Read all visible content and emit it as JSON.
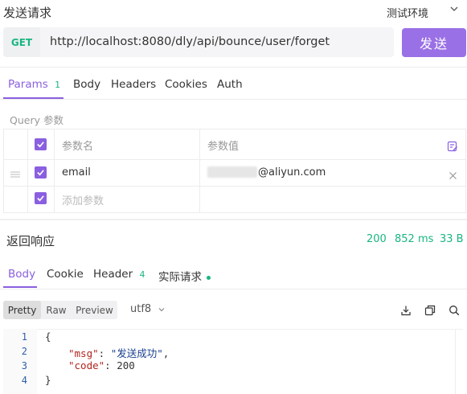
{
  "header": {
    "title": "发送请求",
    "environment": "测试环境"
  },
  "request": {
    "method": "GET",
    "url": "http://localhost:8080/dly/api/bounce/user/forget",
    "send_label": "发送"
  },
  "request_tabs": [
    {
      "label": "Params",
      "badge": "1"
    },
    {
      "label": "Body"
    },
    {
      "label": "Headers"
    },
    {
      "label": "Cookies"
    },
    {
      "label": "Auth"
    }
  ],
  "query": {
    "label": "Query 参数",
    "col_name": "参数名",
    "col_value": "参数值",
    "rows": [
      {
        "name": "email",
        "value_suffix": "@aliyun.com"
      }
    ],
    "add_placeholder": "添加参数"
  },
  "response": {
    "title": "返回响应",
    "status_code": "200",
    "time": "852 ms",
    "size": "33 B",
    "tabs": [
      {
        "label": "Body"
      },
      {
        "label": "Cookie"
      },
      {
        "label": "Header",
        "badge": "4"
      },
      {
        "label": "实际请求"
      }
    ],
    "view_modes": [
      "Pretty",
      "Raw",
      "Preview"
    ],
    "encoding": "utf8",
    "code": {
      "line_numbers": [
        "1",
        "2",
        "3",
        "4"
      ],
      "open_brace": "{",
      "msg_key": "\"msg\"",
      "msg_value": "\"发送成功\"",
      "code_key": "\"code\"",
      "code_value": "200",
      "close_brace": "}"
    }
  },
  "colors": {
    "accent": "#8a5fe0",
    "send_button": "#9a70e6",
    "success": "#19b67f"
  },
  "icons": [
    "chevron-down-icon",
    "check-icon",
    "drag-handle-icon",
    "bulk-edit-icon",
    "remove-icon",
    "download-icon",
    "copy-icon",
    "search-icon",
    "status-dot-icon"
  ]
}
